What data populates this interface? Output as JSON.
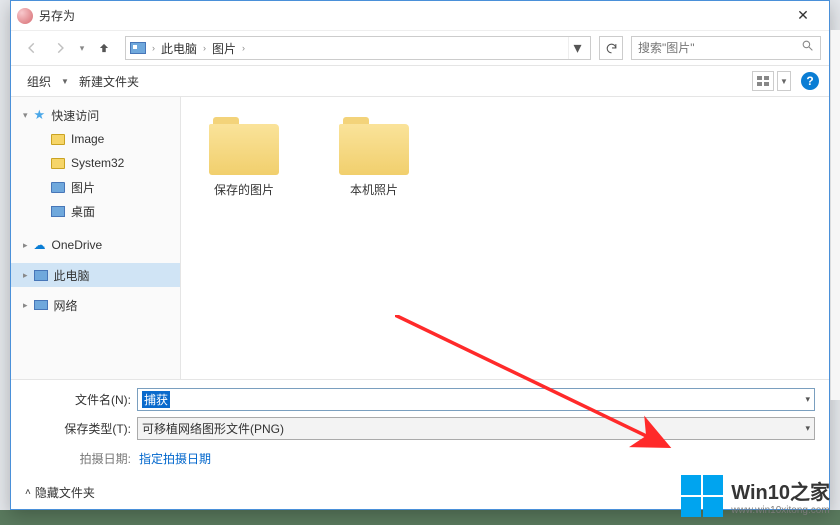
{
  "titlebar": {
    "title": "另存为",
    "close": "✕"
  },
  "nav": {
    "back": "←",
    "forward": "→",
    "up": "↑"
  },
  "breadcrumb": {
    "root": "此电脑",
    "folder": "图片",
    "sep": "›"
  },
  "search": {
    "placeholder": "搜索\"图片\""
  },
  "toolbar": {
    "organize": "组织",
    "new_folder": "新建文件夹",
    "help": "?"
  },
  "sidebar": {
    "quick_access": "快速访问",
    "items": [
      "Image",
      "System32",
      "图片",
      "桌面"
    ],
    "onedrive": "OneDrive",
    "this_pc": "此电脑",
    "network": "网络"
  },
  "folders": [
    {
      "name": "保存的图片"
    },
    {
      "name": "本机照片"
    }
  ],
  "form": {
    "filename_label": "文件名(N):",
    "filename_value": "捕获",
    "filetype_label": "保存类型(T):",
    "filetype_value": "可移植网络图形文件(PNG)",
    "date_label": "拍摄日期:",
    "date_link": "指定拍摄日期"
  },
  "footer": {
    "hide_folders": "隐藏文件夹"
  },
  "watermark": {
    "title": "Win10之家",
    "url": "www.win10xitong.com"
  }
}
